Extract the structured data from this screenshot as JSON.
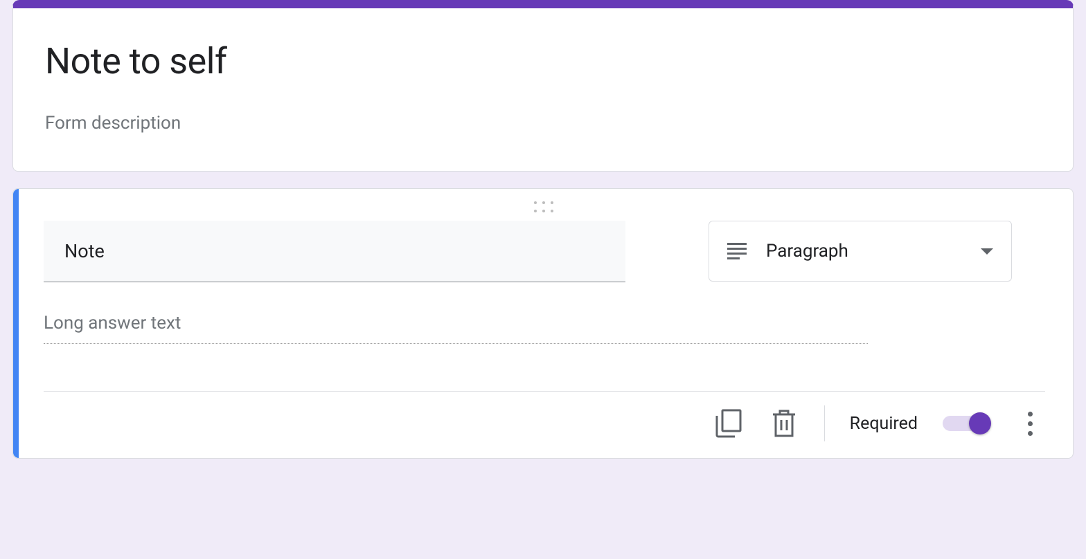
{
  "header": {
    "title": "Note to self",
    "description_placeholder": "Form description"
  },
  "question": {
    "title": "Note",
    "type_label": "Paragraph",
    "answer_placeholder": "Long answer text",
    "footer": {
      "required_label": "Required",
      "required_on": true
    }
  },
  "colors": {
    "accent": "#673ab7",
    "active_border": "#4285f4",
    "background": "#f0ebf8"
  }
}
